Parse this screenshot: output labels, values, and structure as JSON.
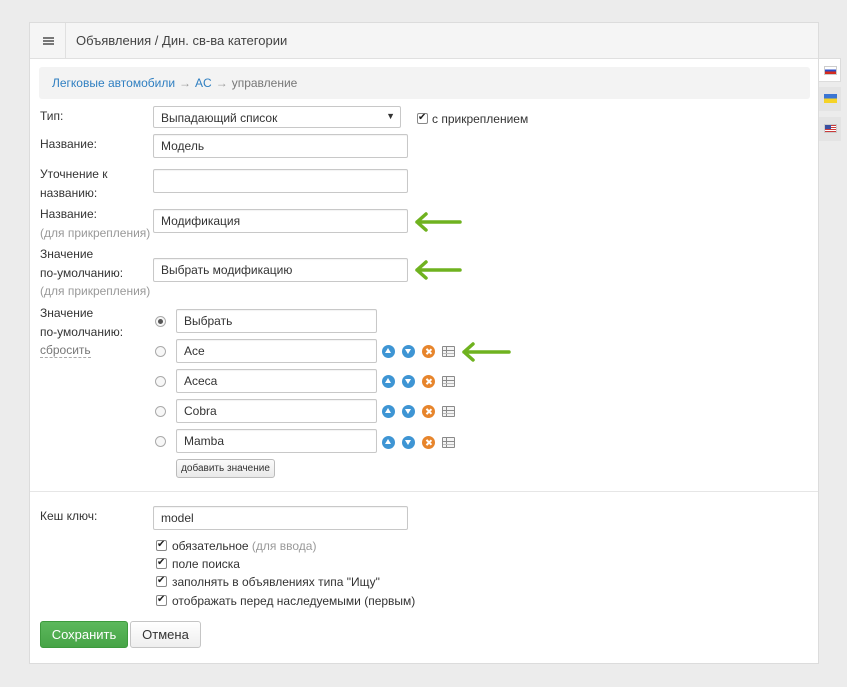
{
  "header": {
    "title": "Объявления / Дин. св-ва категории"
  },
  "breadcrumb": {
    "items": [
      "Легковые автомобили",
      "AC"
    ],
    "separator": "→",
    "current": "управление"
  },
  "languages": [
    "ru",
    "ua",
    "en"
  ],
  "form": {
    "type": {
      "label": "Тип:",
      "value": "Выпадающий список",
      "attach_label": "с прикреплением",
      "attach_checked": true
    },
    "name": {
      "label": "Название:",
      "value": "Модель"
    },
    "clarification": {
      "label_line1": "Уточнение к",
      "label_line2": "названию:",
      "value": ""
    },
    "name_attach": {
      "label": "Название:",
      "sub": "(для прикрепления)",
      "value": "Модификация"
    },
    "default_attach": {
      "label_line1": "Значение",
      "label_line2": "по-умолчанию:",
      "sub": "(для прикрепления)",
      "value": "Выбрать модификацию"
    },
    "values": {
      "label_line1": "Значение",
      "label_line2": "по-умолчанию:",
      "reset_label": "сбросить",
      "default_value": "Выбрать",
      "items": [
        "Ace",
        "Aceca",
        "Cobra",
        "Mamba"
      ],
      "add_label": "добавить значение"
    },
    "cache_key": {
      "label": "Кеш ключ:",
      "value": "model"
    },
    "options": [
      {
        "label": "обязательное",
        "sub": "(для ввода)",
        "checked": true
      },
      {
        "label": "поле поиска",
        "sub": "",
        "checked": true
      },
      {
        "label": "заполнять в объявлениях типа \"Ищу\"",
        "sub": "",
        "checked": true
      },
      {
        "label": "отображать перед наследуемыми (первым)",
        "sub": "",
        "checked": true
      }
    ]
  },
  "actions": {
    "save_label": "Сохранить",
    "cancel_label": "Отмена"
  },
  "colors": {
    "accent": "#2f7fc1",
    "save": "#5cb85c",
    "arrow_annotation": "#6fb21f",
    "delete_icon": "#e7852c"
  }
}
